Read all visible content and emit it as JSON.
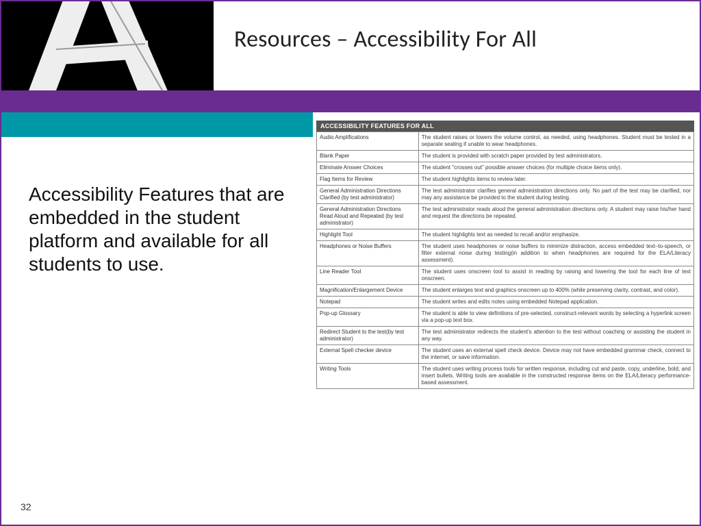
{
  "header": {
    "title": "Resources – Accessibility For All"
  },
  "body": {
    "text": "Accessibility Features that are embedded in the student platform and available for all students to use."
  },
  "page_number": "32",
  "table": {
    "header": "ACCESSIBILITY FEATURES FOR ALL",
    "rows": [
      {
        "name": "Audio Amplifications",
        "desc": "The student raises or lowers the volume control, as needed, using headphones. Student must be tested in a separate seating if unable to wear headphones."
      },
      {
        "name": "Blank Paper",
        "desc": "The student is provided with scratch paper provided by test administrators."
      },
      {
        "name": "Eliminate Answer Choices",
        "desc": "The student \"crosses out\" possible answer choices (for multiple choice items only)."
      },
      {
        "name": "Flag Items for Review",
        "desc": "The student highlights items to review later."
      },
      {
        "name": "General Administration Directions Clarified (by test administrator)",
        "desc": "The test administrator clarifies general administration directions only. No part of the test may be clarified, nor may any assistance be provided to the student during testing."
      },
      {
        "name": "General Administration Directions Read Aloud and Repeated (by test administrator)",
        "desc": "The test administrator reads aloud the general administration directions only. A student may raise his/her hand and request the directions be repeated."
      },
      {
        "name": "Highlight Tool",
        "desc": "The student highlights text as needed to recall and/or emphasize."
      },
      {
        "name": "Headphones or Noise Buffers",
        "desc": "The student uses headphones or noise buffers to minimize distraction, access embedded text–to-speech, or filter external noise during testing(in addition to when headphones are required for the ELA/Literacy assessment)."
      },
      {
        "name": "Line Reader Tool",
        "desc": "The student uses onscreen tool to assist in reading by raising and lowering the tool for each line of text onscreen."
      },
      {
        "name": "Magnification/Enlargement Device",
        "desc": "The student enlarges text and graphics onscreen up to 400% (while preserving clarity, contrast, and color)."
      },
      {
        "name": "Notepad",
        "desc": "The student writes and edits notes using embedded Notepad application."
      },
      {
        "name": "Pop-up Glossary",
        "desc": "The student is able to view definitions of pre-selected, construct-relevant words by selecting a hyperlink screen via a pop-up text box."
      },
      {
        "name": "Redirect Student to the test(by test administrator)",
        "desc": "The test administrator redirects the student's attention to the test without coaching or assisting the student in any way."
      },
      {
        "name": "External Spell checker device",
        "desc": "The student uses an external spell check device. Device may not have embedded grammar check, connect to the internet, or save information."
      },
      {
        "name": "Writing Tools",
        "desc": "The student uses writing process tools for written response, including cut and paste, copy, underline, bold, and insert bullets. Writing tools are available in the constructed response items on the ELA/Literacy performance-based assessment."
      }
    ]
  }
}
